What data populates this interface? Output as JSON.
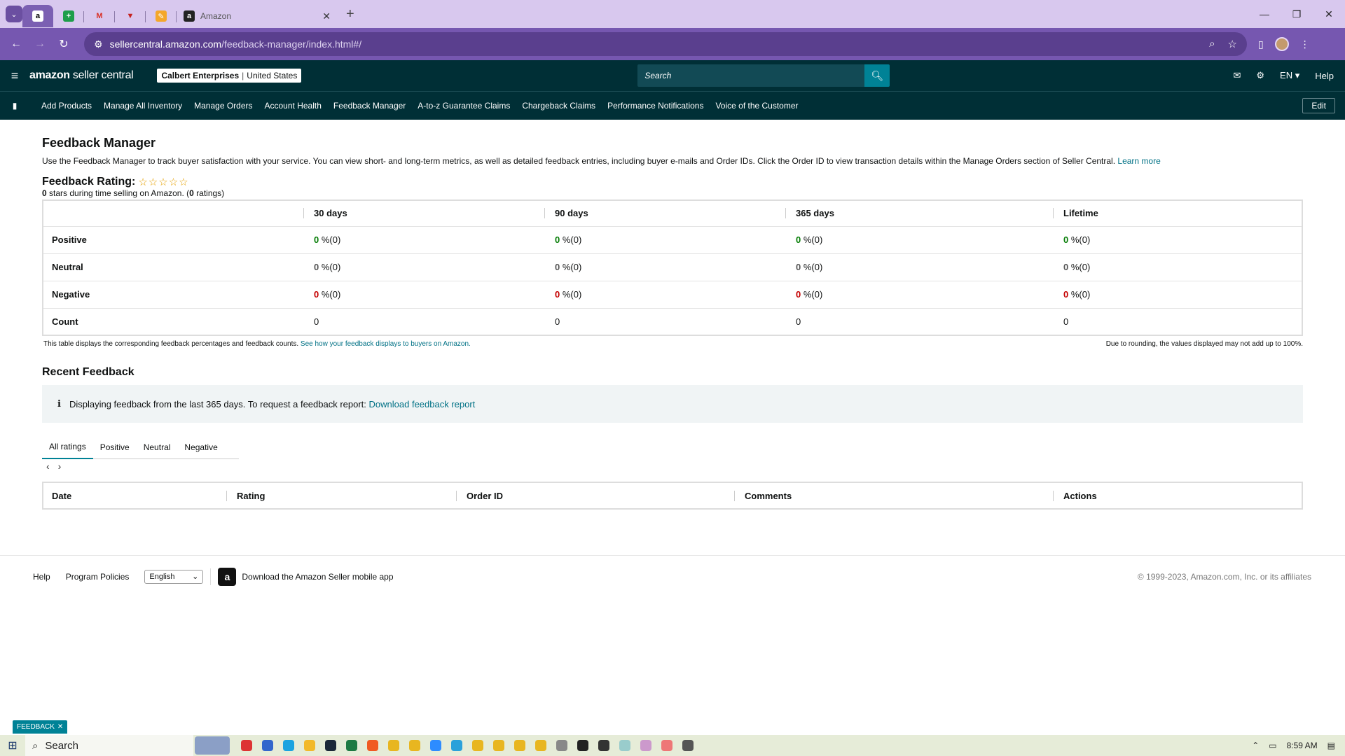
{
  "browser": {
    "active_tab_title": "Amazon",
    "url_host": "sellercentral.amazon.com",
    "url_path": "/feedback-manager/index.html#/"
  },
  "header": {
    "logo_bold": "amazon",
    "logo_rest": " seller central",
    "account_name": "Calbert Enterprises",
    "account_region": "United States",
    "search_placeholder": "Search",
    "language": "EN",
    "help": "Help"
  },
  "nav": {
    "items": [
      "Add Products",
      "Manage All Inventory",
      "Manage Orders",
      "Account Health",
      "Feedback Manager",
      "A-to-z Guarantee Claims",
      "Chargeback Claims",
      "Performance Notifications",
      "Voice of the Customer"
    ],
    "edit": "Edit"
  },
  "main": {
    "title": "Feedback Manager",
    "intro": "Use the Feedback Manager to track buyer satisfaction with your service. You can view short- and long-term metrics, as well as detailed feedback entries, including buyer e-mails and Order IDs. Click the Order ID to view transaction details within the Manage Orders section of Seller Central.",
    "learn_more": "Learn more",
    "rating_label": "Feedback Rating:",
    "stars": "☆☆☆☆☆",
    "rating_value": "0",
    "rating_mid": " stars during time selling on Amazon. (",
    "rating_count": "0",
    "rating_end": " ratings)"
  },
  "metrics": {
    "columns": [
      "30 days",
      "90 days",
      "365 days",
      "Lifetime"
    ],
    "rows": [
      {
        "label": "Positive",
        "values": [
          "0",
          "0",
          "0",
          "0"
        ],
        "suffix": " %(0)"
      },
      {
        "label": "Neutral",
        "values": [
          "0",
          "0",
          "0",
          "0"
        ],
        "suffix": " %(0)"
      },
      {
        "label": "Negative",
        "values": [
          "0",
          "0",
          "0",
          "0"
        ],
        "suffix": " %(0)"
      },
      {
        "label": "Count",
        "values": [
          "0",
          "0",
          "0",
          "0"
        ]
      }
    ],
    "foot_left": "This table displays the corresponding feedback percentages and feedback counts.",
    "foot_link": "See how your feedback displays to buyers on Amazon.",
    "foot_right": "Due to rounding, the values displayed may not add up to 100%."
  },
  "recent": {
    "title": "Recent Feedback",
    "info": "Displaying feedback from the last 365 days. To request a feedback report:",
    "info_link": "Download feedback report",
    "tabs": [
      "All ratings",
      "Positive",
      "Neutral",
      "Negative"
    ],
    "columns": [
      "Date",
      "Rating",
      "Order ID",
      "Comments",
      "Actions"
    ]
  },
  "footer": {
    "help": "Help",
    "policies": "Program Policies",
    "language": "English",
    "app": "Download the Amazon Seller mobile app",
    "copyright": "© 1999-2023, Amazon.com, Inc. or its affiliates"
  },
  "feedback_tab": "FEEDBACK",
  "taskbar": {
    "search": "Search",
    "time": "8:59 AM"
  }
}
